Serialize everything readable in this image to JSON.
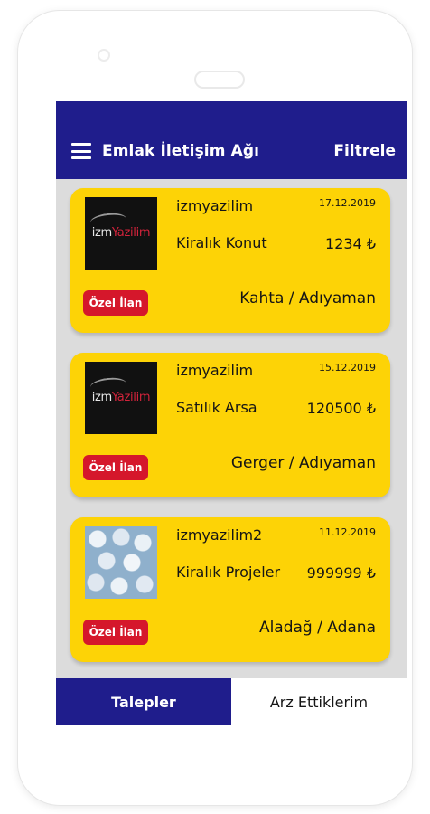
{
  "app_bar": {
    "title": "Emlak İletişim Ağı",
    "filter_label": "Filtrele",
    "color": "#1f1d8c"
  },
  "listings": [
    {
      "username": "izmyazilim",
      "date": "17.12.2019",
      "type": "Kiralık Konut",
      "price": "1234 ₺",
      "location": "Kahta / Adıyaman",
      "badge": "Özel İlan",
      "image": {
        "logo_left": "izm",
        "logo_right": "Yazilim"
      }
    },
    {
      "username": "izmyazilim",
      "date": "15.12.2019",
      "type": "Satılık Arsa",
      "price": "120500 ₺",
      "location": "Gerger / Adıyaman",
      "badge": "Özel İlan",
      "image": {
        "logo_left": "izm",
        "logo_right": "Yazilim"
      }
    },
    {
      "username": "izmyazilim2",
      "date": "11.12.2019",
      "type": "Kiralık Projeler",
      "price": "999999 ₺",
      "location": "Aladağ / Adana",
      "badge": "Özel İlan",
      "image": {
        "icon": "pills-photo"
      }
    }
  ],
  "bottom_nav": {
    "tabs": [
      {
        "label": "Talepler",
        "active": true
      },
      {
        "label": "Arz Ettiklerim",
        "active": false
      }
    ]
  },
  "colors": {
    "card": "#fdd306",
    "badge": "#d5172b",
    "background": "#dcdcdc"
  }
}
